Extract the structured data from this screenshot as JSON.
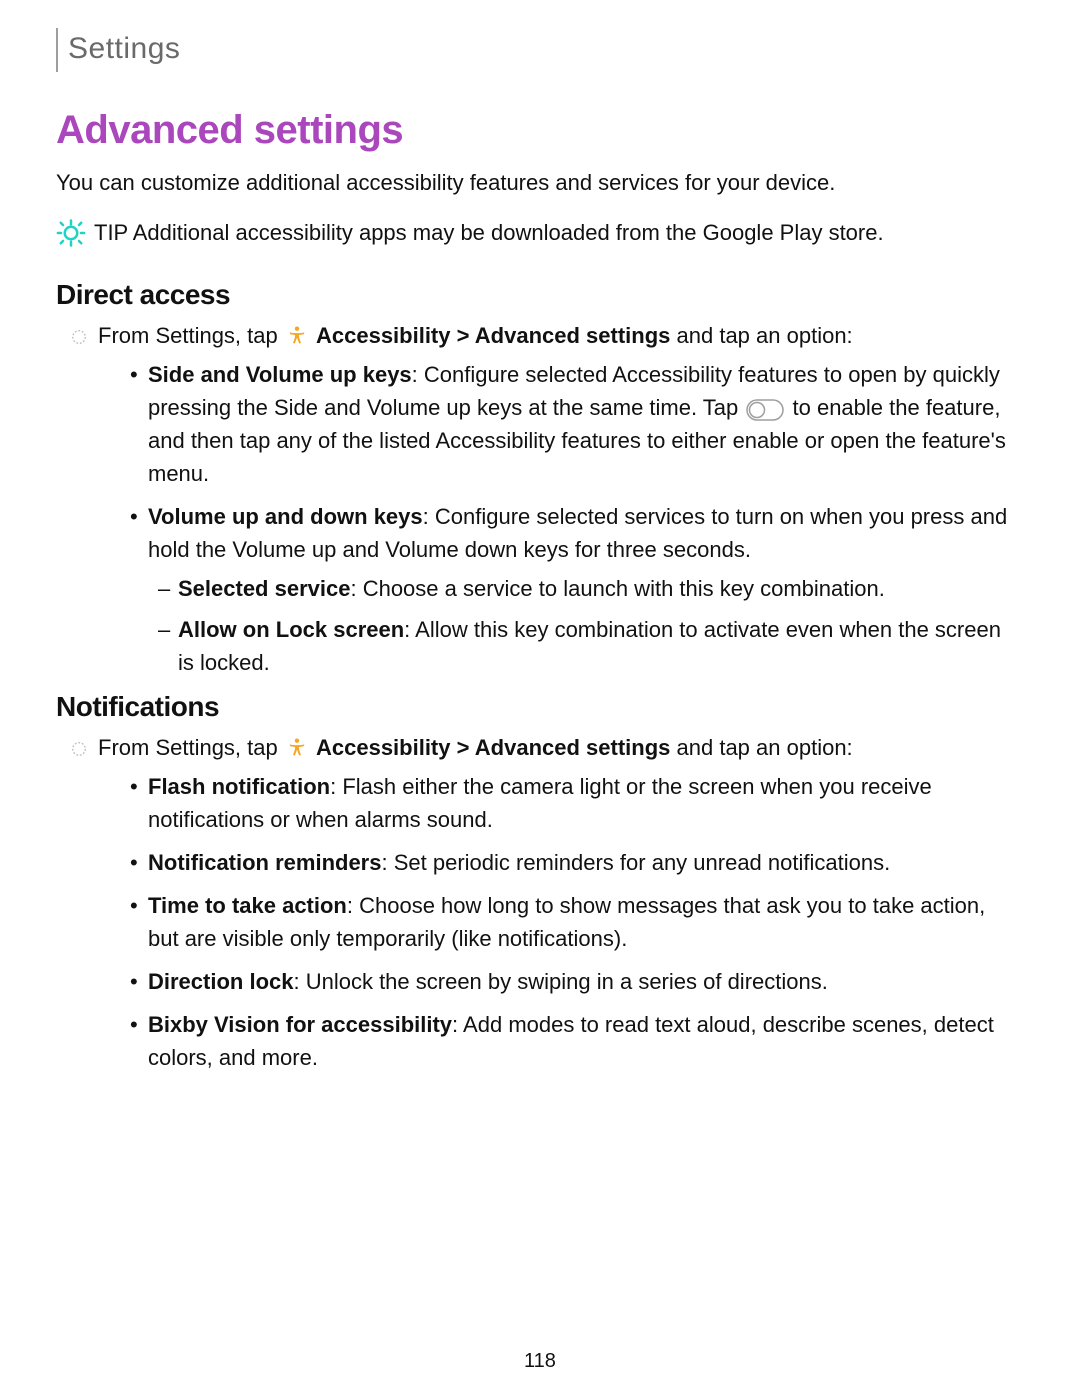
{
  "header": {
    "title": "Settings"
  },
  "main": {
    "heading": "Advanced settings",
    "intro": "You can customize additional accessibility features and services for your device.",
    "tip": {
      "label": "TIP",
      "text": "Additional accessibility apps may be downloaded from the Google Play store."
    },
    "sections": {
      "direct_access": {
        "heading": "Direct access",
        "step_prefix": "From Settings, tap ",
        "path_accessibility": "Accessibility",
        "path_sep": " > ",
        "path_advanced": "Advanced settings",
        "step_suffix": " and tap an option:",
        "items": [
          {
            "bold": "Side and Volume up keys",
            "before_toggle": ": Configure selected Accessibility features to open by quickly pressing the Side and Volume up keys at the same time. Tap ",
            "after_toggle": " to enable the feature, and then tap any of the listed Accessibility features to either enable or open the feature's menu."
          },
          {
            "bold": "Volume up and down keys",
            "text": ": Configure selected services to turn on when you press and hold the Volume up and Volume down keys for three seconds.",
            "sub": [
              {
                "bold": "Selected service",
                "text": ": Choose a service to launch with this key combination."
              },
              {
                "bold": "Allow on Lock screen",
                "text": ": Allow this key combination to activate even when the screen is locked."
              }
            ]
          }
        ]
      },
      "notifications": {
        "heading": "Notifications",
        "step_prefix": "From Settings, tap ",
        "path_accessibility": "Accessibility",
        "path_sep": " > ",
        "path_advanced": "Advanced settings",
        "step_suffix": " and tap an option:",
        "items": [
          {
            "bold": "Flash notification",
            "text": ": Flash either the camera light or the screen when you receive notifications or when alarms sound."
          },
          {
            "bold": "Notification reminders",
            "text": ": Set periodic reminders for any unread notifications."
          },
          {
            "bold": "Time to take action",
            "text": ": Choose how long to show messages that ask you to take action, but are visible only temporarily (like notifications)."
          },
          {
            "bold": "Direction lock",
            "text": ": Unlock the screen by swiping in a series of directions."
          },
          {
            "bold": "Bixby Vision for accessibility",
            "text": ": Add modes to read text aloud, describe scenes, detect colors, and more."
          }
        ]
      }
    }
  },
  "page_number": "118"
}
